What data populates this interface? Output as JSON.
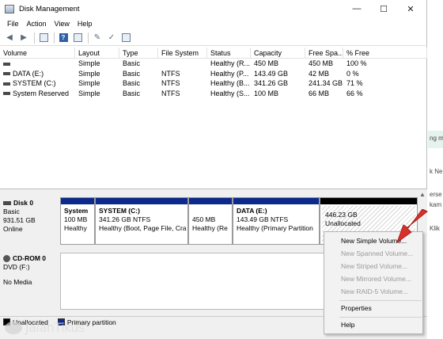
{
  "window": {
    "title": "Disk Management"
  },
  "window_controls": {
    "minimize": "—",
    "maximize": "☐",
    "close": "✕"
  },
  "menu": {
    "items": [
      "File",
      "Action",
      "View",
      "Help"
    ]
  },
  "volume_table": {
    "headers": [
      "Volume",
      "Layout",
      "Type",
      "File System",
      "Status",
      "Capacity",
      "Free Spa...",
      "% Free"
    ],
    "rows": [
      [
        "",
        "Simple",
        "Basic",
        "",
        "Healthy (R...",
        "450 MB",
        "450 MB",
        "100 %"
      ],
      [
        "DATA (E:)",
        "Simple",
        "Basic",
        "NTFS",
        "Healthy (P...",
        "143.49 GB",
        "42 MB",
        "0 %"
      ],
      [
        "SYSTEM (C:)",
        "Simple",
        "Basic",
        "NTFS",
        "Healthy (B...",
        "341.26 GB",
        "241.34 GB",
        "71 %"
      ],
      [
        "System Reserved",
        "Simple",
        "Basic",
        "NTFS",
        "Healthy (S...",
        "100 MB",
        "66 MB",
        "66 %"
      ]
    ]
  },
  "disk0": {
    "name": "Disk 0",
    "type": "Basic",
    "size": "931.51 GB",
    "status": "Online",
    "partitions": [
      {
        "line1": "System",
        "line2": "100 MB",
        "line3": "Healthy"
      },
      {
        "line1": "SYSTEM (C:)",
        "line2": "341.26 GB NTFS",
        "line3": "Healthy (Boot, Page File, Cra"
      },
      {
        "line1": "",
        "line2": "450 MB",
        "line3": "Healthy (Re"
      },
      {
        "line1": "DATA (E:)",
        "line2": "143.49 GB NTFS",
        "line3": "Healthy (Primary Partition"
      },
      {
        "line1": "",
        "line2": "446.23 GB",
        "line3": "Unallocated"
      }
    ]
  },
  "cdrom": {
    "name": "CD-ROM 0",
    "type": "DVD (F:)",
    "status": "No Media"
  },
  "legend": {
    "unallocated": "Unallocated",
    "primary": "Primary partition"
  },
  "context_menu": {
    "items": [
      {
        "label": "New Simple Volume...",
        "enabled": true
      },
      {
        "label": "New Spanned Volume...",
        "enabled": false
      },
      {
        "label": "New Striped Volume...",
        "enabled": false
      },
      {
        "label": "New Mirrored Volume...",
        "enabled": false
      },
      {
        "label": "New RAID-5 Volume...",
        "enabled": false
      },
      {
        "label": "Properties",
        "enabled": true
      },
      {
        "label": "Help",
        "enabled": true
      }
    ]
  },
  "side_fragments": [
    "ng ma",
    "k Ne",
    "erse",
    "kam",
    "Klik"
  ],
  "watermark": "JalanTikus",
  "colors": {
    "primary_partition": "#0c2a8c",
    "unallocated": "#000000",
    "arrow": "#d9302a"
  }
}
